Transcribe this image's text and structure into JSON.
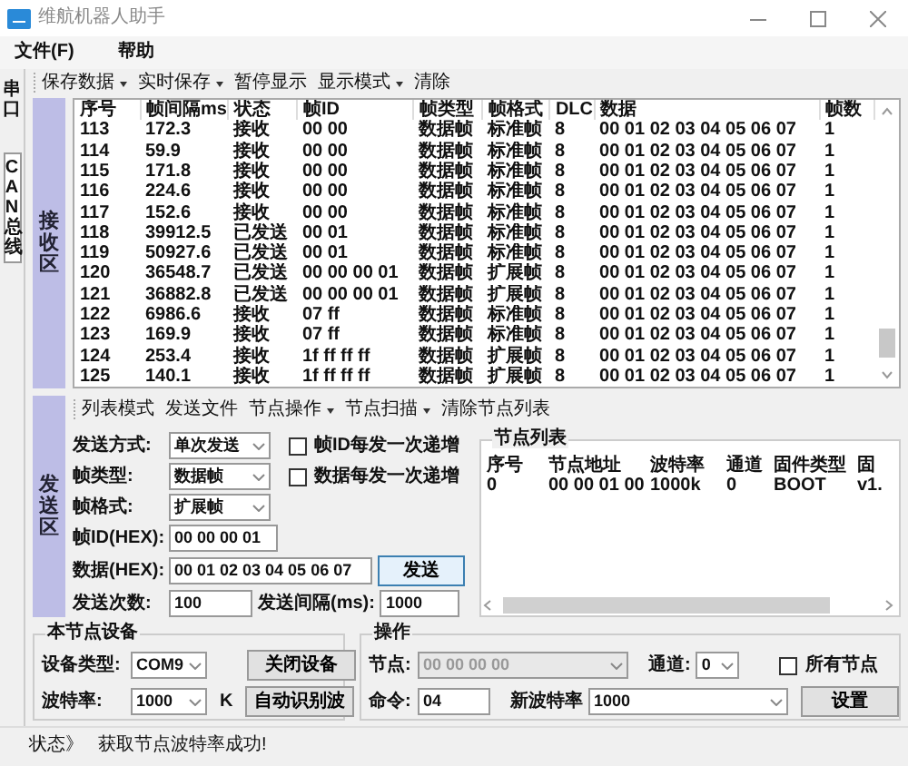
{
  "window": {
    "title": "维航机器人助手"
  },
  "menu": [
    "文件(F)",
    "帮助"
  ],
  "side_tabs": [
    {
      "label": "串口",
      "selected": false
    },
    {
      "label": "CAN总线",
      "selected": true
    }
  ],
  "receive": {
    "area_label": "接收区",
    "toolbar": [
      {
        "label": "保存数据",
        "dropdown": true
      },
      {
        "label": "实时保存",
        "dropdown": true
      },
      {
        "label": "暂停显示",
        "dropdown": false
      },
      {
        "label": "显示模式",
        "dropdown": true
      },
      {
        "label": "清除",
        "dropdown": false
      }
    ],
    "table": {
      "columns": [
        "序号",
        "帧间隔ms",
        "状态",
        "帧ID",
        "帧类型",
        "帧格式",
        "DLC",
        "数据",
        "帧数"
      ],
      "rows": [
        [
          "113",
          "172.3",
          "接收",
          "00 00",
          "数据帧",
          "标准帧",
          "8",
          "00 01 02 03 04 05 06 07",
          "1"
        ],
        [
          "114",
          "59.9",
          "接收",
          "00 00",
          "数据帧",
          "标准帧",
          "8",
          "00 01 02 03 04 05 06 07",
          "1"
        ],
        [
          "115",
          "171.8",
          "接收",
          "00 00",
          "数据帧",
          "标准帧",
          "8",
          "00 01 02 03 04 05 06 07",
          "1"
        ],
        [
          "116",
          "224.6",
          "接收",
          "00 00",
          "数据帧",
          "标准帧",
          "8",
          "00 01 02 03 04 05 06 07",
          "1"
        ],
        [
          "117",
          "152.6",
          "接收",
          "00 00",
          "数据帧",
          "标准帧",
          "8",
          "00 01 02 03 04 05 06 07",
          "1"
        ],
        [
          "118",
          "39912.5",
          "已发送",
          "00 01",
          "数据帧",
          "标准帧",
          "8",
          "00 01 02 03 04 05 06 07",
          "1"
        ],
        [
          "119",
          "50927.6",
          "已发送",
          "00 01",
          "数据帧",
          "标准帧",
          "8",
          "00 01 02 03 04 05 06 07",
          "1"
        ],
        [
          "120",
          "36548.7",
          "已发送",
          "00 00 00 01",
          "数据帧",
          "扩展帧",
          "8",
          "00 01 02 03 04 05 06 07",
          "1"
        ],
        [
          "121",
          "36882.8",
          "已发送",
          "00 00 00 01",
          "数据帧",
          "扩展帧",
          "8",
          "00 01 02 03 04 05 06 07",
          "1"
        ],
        [
          "122",
          "6986.6",
          "接收",
          "07 ff",
          "数据帧",
          "标准帧",
          "8",
          "00 01 02 03 04 05 06 07",
          "1"
        ],
        [
          "123",
          "169.9",
          "接收",
          "07 ff",
          "数据帧",
          "标准帧",
          "8",
          "00 01 02 03 04 05 06 07",
          "1"
        ],
        [
          "124",
          "253.4",
          "接收",
          "1f ff ff ff",
          "数据帧",
          "扩展帧",
          "8",
          "00 01 02 03 04 05 06 07",
          "1"
        ],
        [
          "125",
          "140.1",
          "接收",
          "1f ff ff ff",
          "数据帧",
          "扩展帧",
          "8",
          "00 01 02 03 04 05 06 07",
          "1"
        ]
      ]
    }
  },
  "send": {
    "area_label": "发送区",
    "toolbar": [
      {
        "label": "列表模式",
        "dropdown": false
      },
      {
        "label": "发送文件",
        "dropdown": false
      },
      {
        "label": "节点操作",
        "dropdown": true
      },
      {
        "label": "节点扫描",
        "dropdown": true
      },
      {
        "label": "清除节点列表",
        "dropdown": false
      }
    ],
    "send_mode": {
      "label": "发送方式:",
      "value": "单次发送"
    },
    "frame_type": {
      "label": "帧类型:",
      "value": "数据帧"
    },
    "frame_format": {
      "label": "帧格式:",
      "value": "扩展帧"
    },
    "checkboxes": [
      {
        "label": "帧ID每发一次递增",
        "checked": false
      },
      {
        "label": "数据每发一次递增",
        "checked": false
      }
    ],
    "frame_id": {
      "label": "帧ID(HEX):",
      "value": "00 00 00 01"
    },
    "data": {
      "label": "数据(HEX):",
      "value": "00 01 02 03 04 05 06 07"
    },
    "send_button": "发送",
    "send_count": {
      "label": "发送次数:",
      "value": "100"
    },
    "send_interval": {
      "label": "发送间隔(ms):",
      "value": "1000"
    },
    "node_list": {
      "title": "节点列表",
      "columns": [
        "序号",
        "节点地址",
        "波特率",
        "通道",
        "固件类型",
        "固"
      ],
      "rows": [
        [
          "0",
          "00 00 01 00",
          "1000k",
          "0",
          "BOOT",
          "v1."
        ]
      ]
    }
  },
  "device": {
    "title": "本节点设备",
    "device_type": {
      "label": "设备类型:",
      "value": "COM9"
    },
    "close_button": "关闭设备",
    "baud": {
      "label": "波特率:",
      "value": "1000",
      "unit": "K"
    },
    "auto_button": "自动识别波"
  },
  "operation": {
    "title": "操作",
    "node": {
      "label": "节点:",
      "value": "00 00 00 00",
      "disabled": true
    },
    "channel": {
      "label": "通道:",
      "value": "0"
    },
    "all_nodes": {
      "label": "所有节点",
      "checked": false
    },
    "command": {
      "label": "命令:",
      "value": "04"
    },
    "new_baud": {
      "label": "新波特率",
      "value": "1000"
    },
    "set_button": "设置"
  },
  "status_bar": {
    "label": "状态》",
    "message": "获取节点波特率成功!"
  }
}
